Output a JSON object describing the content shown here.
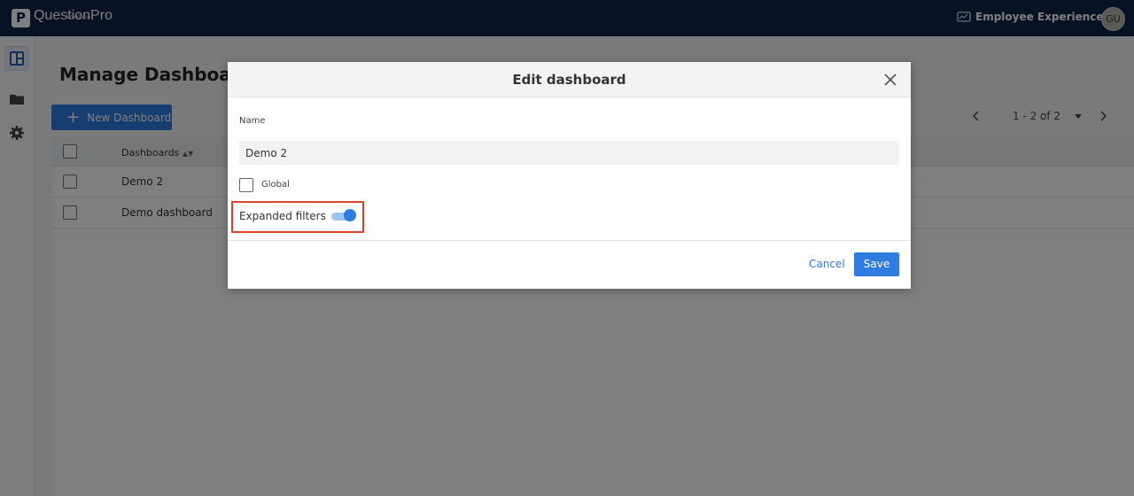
{
  "topbar": {
    "logo_letter": "P",
    "logo_text": "QuestionPro",
    "logo_sub": "Workforce",
    "product": "Employee Experience",
    "avatar": "GU"
  },
  "main": {
    "title": "Manage Dashboards",
    "new_button": "New Dashboard",
    "pager": "1 - 2 of 2",
    "table": {
      "header": "Dashboards",
      "rows": [
        "Demo 2",
        "Demo dashboard"
      ]
    }
  },
  "modal": {
    "title": "Edit dashboard",
    "name_label": "Name",
    "name_value": "Demo 2",
    "global_label": "Global",
    "global_checked": false,
    "expanded_filters_label": "Expanded filters",
    "expanded_filters_on": true,
    "cancel": "Cancel",
    "save": "Save"
  },
  "colors": {
    "topbar": "#11244a",
    "accent": "#2f7de1",
    "highlight": "#d9432e"
  },
  "icons": {
    "sidebar": [
      "dashboard-icon",
      "folder-icon",
      "gear-icon"
    ],
    "close": "close-icon"
  }
}
